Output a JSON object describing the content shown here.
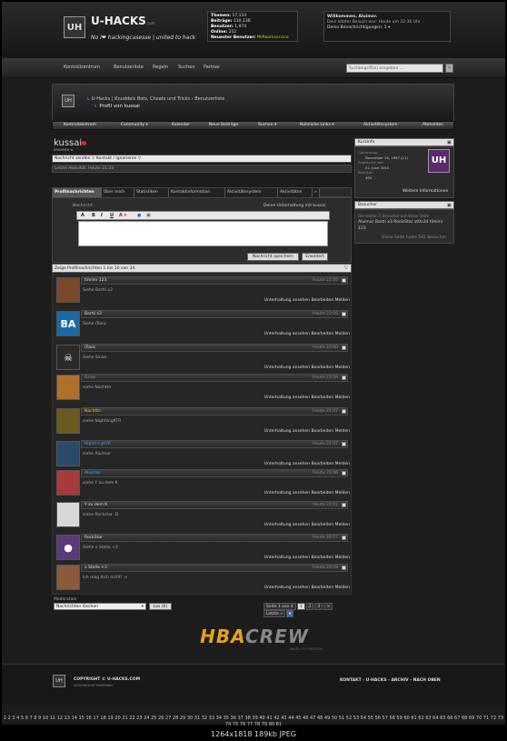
{
  "header": {
    "logo_text": "UH",
    "site_title": "U-HACKS",
    "site_title_suffix": ".com",
    "slogan": "No I❤ hackingcasesse | united to hack",
    "stats": [
      {
        "label": "Themen:",
        "value": "17,114"
      },
      {
        "label": "Beiträge:",
        "value": "110,136"
      },
      {
        "label": "Benutzer:",
        "value": "1,974"
      },
      {
        "label": "Online:",
        "value": "212"
      },
      {
        "label": "Neuester Benutzer:",
        "value": "MrRoomservice"
      }
    ],
    "welcome_line1": "Willkommen, Aluimar.",
    "welcome_line2": "Dein letzter Besuch war: Heute um 22:36 Uhr",
    "welcome_line3": "Deine Benachrichtigungen: 1 ▾"
  },
  "topnav": {
    "items": [
      "Kontrollzentrum",
      "Benutzerliste",
      "Regeln",
      "Suchen",
      "Partner"
    ],
    "search_placeholder": "Suchbegriff(e) eingeben ...",
    "search_button": "»"
  },
  "breadcrumb": {
    "icon_text": "UH",
    "path": "U-Hacks | Knuddels Bots, Cheats und Tricks › Benutzerliste",
    "current": "Profil von kussai"
  },
  "mainnav": {
    "items": [
      "Kontrollzentrum",
      "Community ▾",
      "Kalender",
      "Neue Beiträge",
      "Suchen ▾",
      "Nützliche Links ▾",
      "Aktivitätssystem",
      "Abmelden"
    ]
  },
  "profile": {
    "username": "kussai",
    "rank": "SPAMMER",
    "actions": "Nachricht senden ▽  Kontakt / Ignorieren ▽",
    "last_activity": "Letzte Aktivität: Heute 21:33"
  },
  "tabs": [
    "Profilnachrichten",
    "Über mich",
    "Statistiken",
    "Kontaktinformation",
    "Aktivitätssystem",
    "Aktivitäten",
    "»"
  ],
  "editor": {
    "label": "Nachricht:",
    "right_label": "Deine Unterhaltung mit kussai",
    "toolbar": [
      "A",
      "B",
      "I",
      "U",
      "A ▾",
      "●",
      "▣"
    ],
    "save_button": "Nachricht speichern",
    "advanced_button": "Erweitert"
  },
  "messages_header": "Zeige Profilnachrichten 1 bis 10 von 34",
  "messages": [
    {
      "name": "timimi 123",
      "time": "Heute 22:35",
      "text": "Siehe Bartli x3",
      "avatar": "",
      "avatar_color": "#7a4a2a",
      "name_color": "#dddddd"
    },
    {
      "name": "Bartli x3",
      "time": "Heute 22:35",
      "text": "Siehe iToxic",
      "avatar": "BA",
      "avatar_color": "#1a6aa8",
      "name_color": "#dddddd"
    },
    {
      "name": "iToxic",
      "time": "Heute 22:00",
      "text": "Siehe Sinan",
      "avatar": "☠",
      "avatar_color": "#2a2a2a",
      "name_color": "#dddddd"
    },
    {
      "name": "Draw",
      "time": "Heute 21:59",
      "text": "siehe Nachtto",
      "avatar": "",
      "avatar_color": "#b0702a",
      "name_color": "#888888"
    },
    {
      "name": "Nachtto",
      "time": "Heute 21:47",
      "text": "siehe NightlingKTR",
      "avatar": "",
      "avatar_color": "#6a5a20",
      "name_color": "#e8c030"
    },
    {
      "name": "NightlingKTR",
      "time": "Heute 21:47",
      "text": "siehe Aluimar",
      "avatar": "",
      "avatar_color": "#2a4a6a",
      "name_color": "#4a8ad8"
    },
    {
      "name": "Aluimar",
      "time": "Heute 21:46",
      "text": "siehe Y zu dem K",
      "avatar": "",
      "avatar_color": "#a83a3a",
      "name_color": "#4aa8e8"
    },
    {
      "name": "Y zu dem K",
      "time": "Heute 21:01",
      "text": "siehe Rockstar :D",
      "avatar": "",
      "avatar_color": "#d8d8d8",
      "name_color": "#dddddd"
    },
    {
      "name": "RockStar",
      "time": "Heute 20:57",
      "text": "Siehe x Stella <3",
      "avatar": "●",
      "avatar_color": "#5a3a7a",
      "name_color": "#dddddd"
    },
    {
      "name": "x Stella <3",
      "time": "Heute 20:28",
      "text": "Ich mag dich nicht! :x",
      "avatar": "",
      "avatar_color": "#8a5a3a",
      "name_color": "#dddddd"
    }
  ],
  "message_actions": "Unterhaltung ansehen   Bearbeiten   Melden",
  "moderation": {
    "label": "Moderation",
    "select_value": "Nachrichten löschen",
    "go_button": "Los (0)"
  },
  "pager": {
    "label": "Seite 1 von 4",
    "pages": [
      "1",
      "2",
      "3",
      ">",
      "Letzte »",
      "▾"
    ]
  },
  "crew_logo": {
    "text_a": "HBA",
    "text_b": "CREW",
    "subtitle": "ANGEL OF CREATION"
  },
  "sidebar": {
    "profile_head": "Kurzinfo",
    "profile_lines": [
      "Geburtstag",
      "November 16, 1997 (12)",
      "Registriert seit",
      "22. June 2010",
      "Beiträge",
      "490"
    ],
    "badge_text": "UH",
    "more_link": "Weitere Informationen",
    "visitors_head": "Besucher",
    "visitors_intro": "Die letzten 5 Besucher auf dieser Seite",
    "visitors": "Aluimar  Bartli x3  RockiStar  st0n3d  timimi 123",
    "visitor_count": "Diese Seite hatte 542 Besucher"
  },
  "footer": {
    "logo_text": "UH",
    "copyright": "COPYRIGHT © U-HACKS.COM",
    "design": "DESIGNED BY PAWEMAN",
    "links": "KONTAKT - U-HACKS - ARCHIV - NACH OBEN"
  },
  "image_pages": "1 2 3 4 5 6 7 8 9 10 11 12 13 14 15 16 17 18 19 20 21 22 23 24 25 26 27 28 29 30 31 32 33 34 35 36 37 38 39 40 41 42 43 44 45 46 47 48 49 50 51 52 53 54 55 56 57 58 59 60 61 62 63 64 65 66 67 68 69 70 71 72 73 74 75 76 77 78 79 80 81",
  "image_info": "1264x1818  189kb  JPEG"
}
